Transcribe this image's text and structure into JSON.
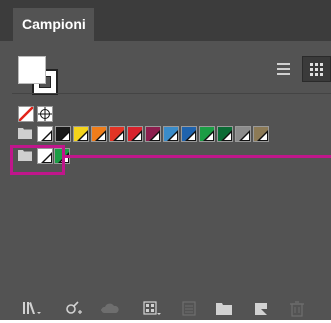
{
  "panel": {
    "tab_label": "Campioni",
    "accent_color": "#c0168c"
  },
  "toolbar": {
    "view_buttons": [
      {
        "name": "list-view",
        "icon": "list-icon",
        "selected": false
      },
      {
        "name": "thumbnail-view",
        "icon": "grid-icon",
        "selected": true
      }
    ]
  },
  "swatches": {
    "special": [
      {
        "name": "none",
        "icon": "none-swatch-icon"
      },
      {
        "name": "registration",
        "icon": "registration-icon"
      }
    ],
    "group1": {
      "icon": "folder-icon",
      "colors": [
        "#ffffff",
        "#1a1a1a",
        "#f4d31b",
        "#ef7d1a",
        "#e23425",
        "#d8222c",
        "#8c1f4e",
        "#3a8cc9",
        "#1f63ad",
        "#1b9d45",
        "#0b6b35",
        "#8b8b8b",
        "#8c7a56"
      ]
    },
    "group2": {
      "icon": "folder-icon",
      "colors": [
        "#ffffff",
        "#1b9d45"
      ]
    }
  },
  "bottom_toolbar": [
    {
      "name": "swatch-libraries-menu",
      "icon": "library-icon",
      "enabled": true
    },
    {
      "name": "place-swatch",
      "icon": "eyedropper-plus-icon",
      "enabled": true
    },
    {
      "name": "cloud-library",
      "icon": "cloud-icon",
      "enabled": false
    },
    {
      "name": "swatch-kind-menu",
      "icon": "swatch-grid-icon",
      "enabled": true
    },
    {
      "name": "swatch-options",
      "icon": "options-icon",
      "enabled": false
    },
    {
      "name": "new-color-group",
      "icon": "folder-icon",
      "enabled": true
    },
    {
      "name": "new-swatch",
      "icon": "new-swatch-icon",
      "enabled": true
    },
    {
      "name": "delete-swatch",
      "icon": "trash-icon",
      "enabled": false
    }
  ]
}
